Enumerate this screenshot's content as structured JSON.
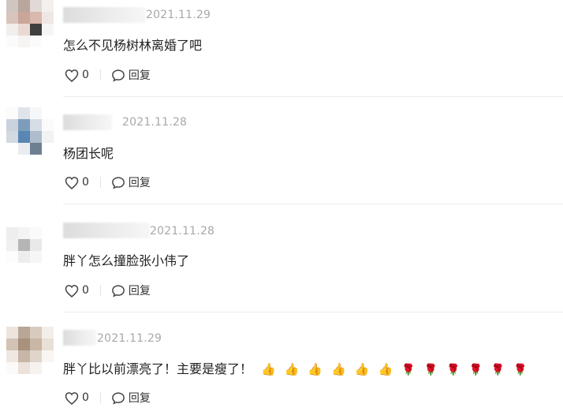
{
  "comments": [
    {
      "date": "2021.11.29",
      "text": "怎么不见杨树林离婚了吧",
      "likes": "0",
      "reply_label": "回复",
      "avatar_colors": [
        "#cfc6c2",
        "#b9a69d",
        "#e1d9d5",
        "#f4f0ee",
        "#d8c4bc",
        "#c9a59a",
        "#d9b9ad",
        "#efe7e3",
        "#f2eeec",
        "#e9d9d2",
        "#3f3f3f",
        "#f7f5f4",
        "#fbfbfb",
        "#f6f4f3",
        "#fbfbfb",
        "#ffffff"
      ]
    },
    {
      "date": "2021.11.28",
      "text": "杨团长呢",
      "likes": "0",
      "reply_label": "回复",
      "avatar_colors": [
        "#fbfbfb",
        "#dfe4ea",
        "#f6f7f9",
        "#ffffff",
        "#c9d2dd",
        "#7d9dbd",
        "#d6dde6",
        "#fafafa",
        "#d2d9e1",
        "#5a86b4",
        "#aebccc",
        "#f2f2f2",
        "#ffffff",
        "#e9edf2",
        "#6f7f92",
        "#ffffff"
      ]
    },
    {
      "date": "2021.11.28",
      "text": "胖丫怎么撞脸张小伟了",
      "likes": "0",
      "reply_label": "回复",
      "avatar_colors": [
        "#ffffff",
        "#ffffff",
        "#ffffff",
        "#ffffff",
        "#eeeeee",
        "#f4f4f4",
        "#fafafa",
        "#ffffff",
        "#f0f0f0",
        "#b5b5b5",
        "#e9e9e9",
        "#ffffff",
        "#fcfcfc",
        "#ededed",
        "#f6f6f6",
        "#ffffff"
      ]
    },
    {
      "date": "2021.11.29",
      "text": "胖丫比以前漂亮了！主要是瘦了！",
      "likes": "0",
      "reply_label": "回复",
      "emojis": [
        "👍",
        "👍",
        "👍",
        "👍",
        "👍",
        "👍",
        "🌹",
        "🌹",
        "🌹",
        "🌹",
        "🌹",
        "🌹"
      ],
      "avatar_colors": [
        "#ede5dd",
        "#b8a796",
        "#d8cbbe",
        "#f3eee9",
        "#d3c3b4",
        "#a8917d",
        "#c9b6a4",
        "#e9e0d8",
        "#efe8e2",
        "#c7b5a5",
        "#e0d5cb",
        "#f8f5f2",
        "#fbfaf8",
        "#eae2db",
        "#f6f2ee",
        "#ffffff"
      ]
    }
  ]
}
